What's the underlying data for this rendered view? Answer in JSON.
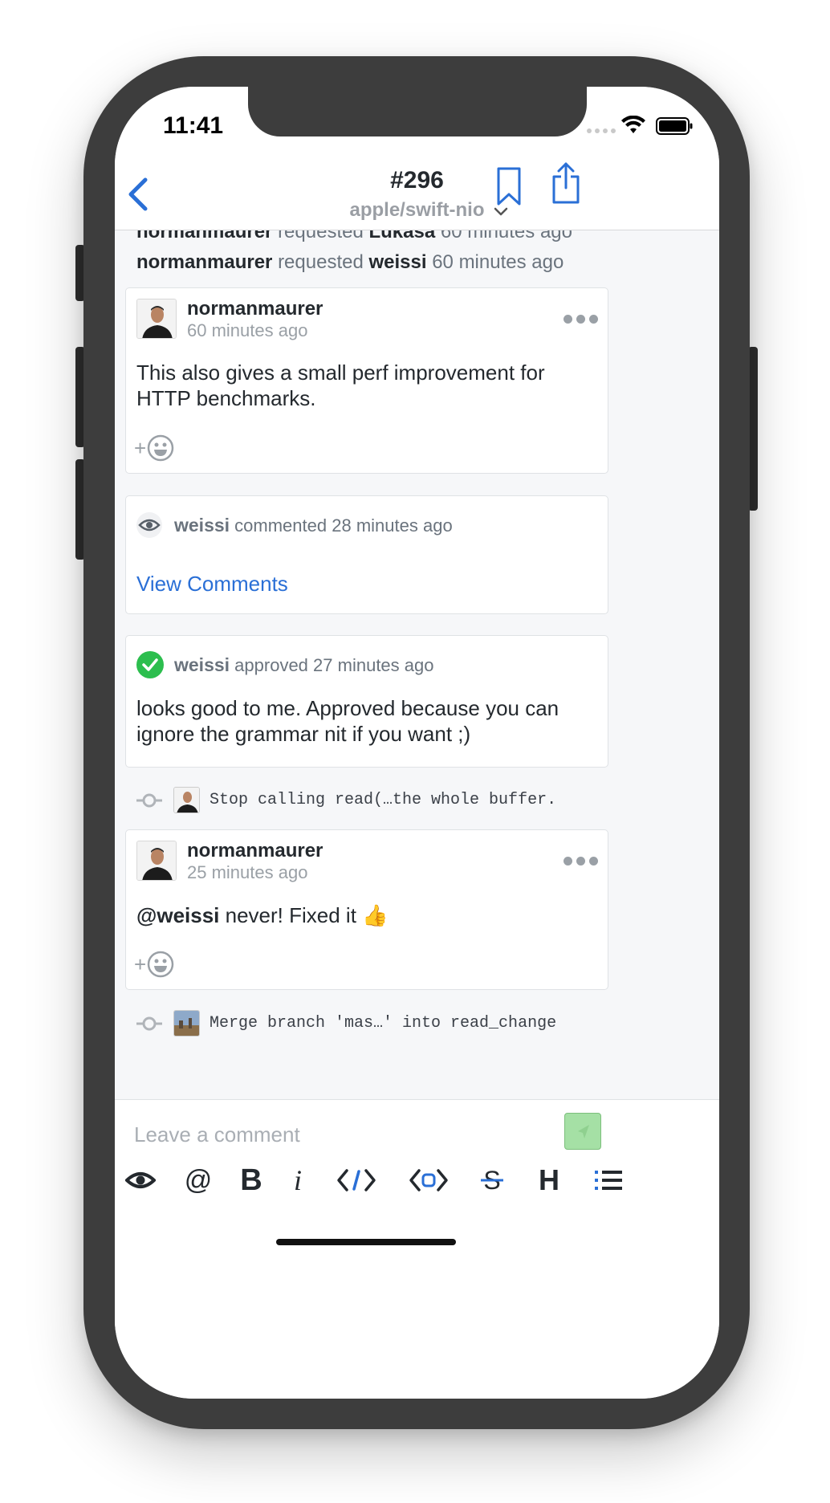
{
  "status_bar": {
    "time": "11:41"
  },
  "nav": {
    "title": "#296",
    "subtitle": "apple/swift-nio",
    "back_icon": "chevron-left-icon",
    "dropdown_icon": "chevron-down-icon",
    "bookmark_icon": "bookmark-icon",
    "share_icon": "share-icon"
  },
  "events": [
    {
      "actor": "normanmaurer",
      "verb": "requested",
      "target": "Lukasa",
      "time": "60 minutes ago"
    },
    {
      "actor": "normanmaurer",
      "verb": "requested",
      "target": "weissi",
      "time": "60 minutes ago"
    }
  ],
  "comment1": {
    "author": "normanmaurer",
    "time": "60 minutes ago",
    "body_line1": "This also gives a small perf improvement for",
    "body_line2": "HTTP benchmarks.",
    "reaction_plus": "+"
  },
  "review_comment": {
    "author": "weissi",
    "action": "commented",
    "time": "28 minutes ago",
    "link": "View Comments",
    "icon": "eye-icon"
  },
  "review_approved": {
    "author": "weissi",
    "action": "approved",
    "time": "27 minutes ago",
    "body_line1": "looks good to me. Approved because you can",
    "body_line2": "ignore the grammar nit if you want ;)",
    "icon": "check-circle-icon"
  },
  "commit1": {
    "message": "Stop calling read(…the whole buffer.",
    "icon": "commit-icon"
  },
  "comment2": {
    "author": "normanmaurer",
    "time": "25 minutes ago",
    "mention": "@weissi",
    "body_rest": " never! Fixed it ",
    "emoji": "👍",
    "reaction_plus": "+"
  },
  "commit2": {
    "message": "Merge branch 'mas…' into read_change",
    "icon": "commit-icon"
  },
  "composer": {
    "placeholder": "Leave a comment",
    "send_icon": "send-icon",
    "tools": [
      "eye-icon",
      "mention-icon",
      "bold-icon",
      "italic-icon",
      "code-icon",
      "code-block-icon",
      "strikethrough-icon",
      "heading-icon",
      "list-icon"
    ],
    "tool_labels": {
      "mention": "@",
      "bold": "B",
      "italic": "i",
      "heading": "H"
    }
  },
  "colors": {
    "accent_blue": "#2a6fd6",
    "approved_green": "#2cbe4e",
    "send_green": "#a5e0a5",
    "text_primary": "#24292e",
    "text_secondary": "#6a737d"
  }
}
